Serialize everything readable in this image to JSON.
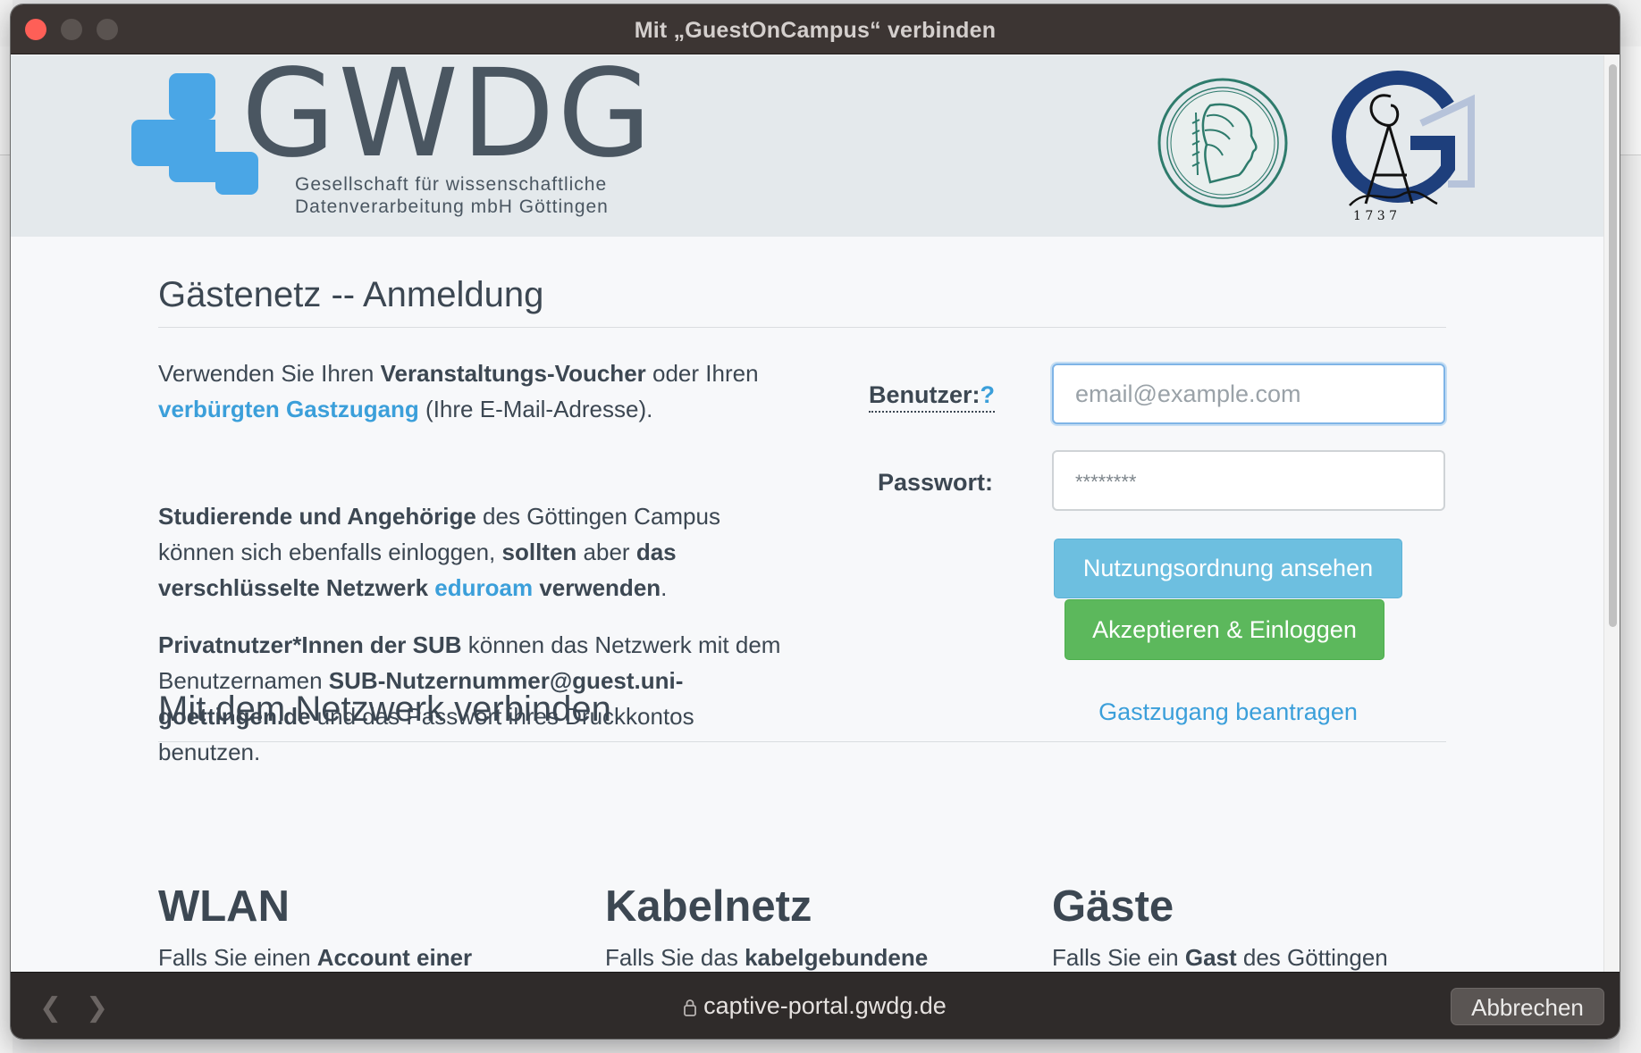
{
  "window": {
    "title": "Mit „GuestOnCampus“ verbinden"
  },
  "header": {
    "logo_text": "GWDG",
    "logo_sub_line1": "Gesellschaft für wissenschaftliche",
    "logo_sub_line2": "Datenverarbeitung mbH Göttingen",
    "seal_year": "1 7 3 7",
    "brand_blue": "#4aa6e6",
    "brand_grey": "#4a5661"
  },
  "login": {
    "heading": "Gästenetz -- Anmeldung",
    "intro": {
      "p1_a": "Verwenden Sie Ihren ",
      "p1_b": "Veranstaltungs-Voucher",
      "p1_c": " oder Ihren ",
      "p1_link": "verbürgten Gastzugang",
      "p1_d": " (Ihre E-Mail-Adresse).",
      "p2_a": "Studierende und Angehörige",
      "p2_b": " des Göttingen Campus können sich ebenfalls einloggen, ",
      "p2_c": "sollten",
      "p2_d": " aber ",
      "p2_e": "das verschlüsselte Netzwerk",
      "p2_link": "eduroam",
      "p2_f": "verwenden",
      "p2_g": ".",
      "p3_a": "Privatnutzer*Innen der SUB",
      "p3_b": " können das Netzwerk mit dem Benutzernamen ",
      "p3_c": "SUB-Nutzernummer@guest.uni-goettingen.de",
      "p3_d": " und das Passwort ihres Druckkontos benutzen."
    },
    "user_label": "Benutzer:",
    "user_help": "?",
    "user_placeholder": "email@example.com",
    "pass_label": "Passwort:",
    "pass_placeholder": "********",
    "terms_button": "Nutzungsordnung ansehen",
    "accept_button": "Akzeptieren & Einloggen",
    "request_link": "Gastzugang beantragen",
    "link_color": "#3b9fda"
  },
  "connect": {
    "heading": "Mit dem Netzwerk verbinden",
    "columns": [
      {
        "title": "WLAN",
        "text_a": "Falls Sie einen ",
        "text_b": "Account einer"
      },
      {
        "title": "Kabelnetz",
        "text_a": "Falls Sie das ",
        "text_b": "kabelgebundene"
      },
      {
        "title": "Gäste",
        "text_a": "Falls Sie ein ",
        "text_b": "Gast",
        "text_c": " des Göttingen"
      }
    ]
  },
  "toolbar": {
    "back_icon": "chevron-left-icon",
    "forward_icon": "chevron-right-icon",
    "url": "captive-portal.gwdg.de",
    "cancel_button": "Abbrechen"
  }
}
